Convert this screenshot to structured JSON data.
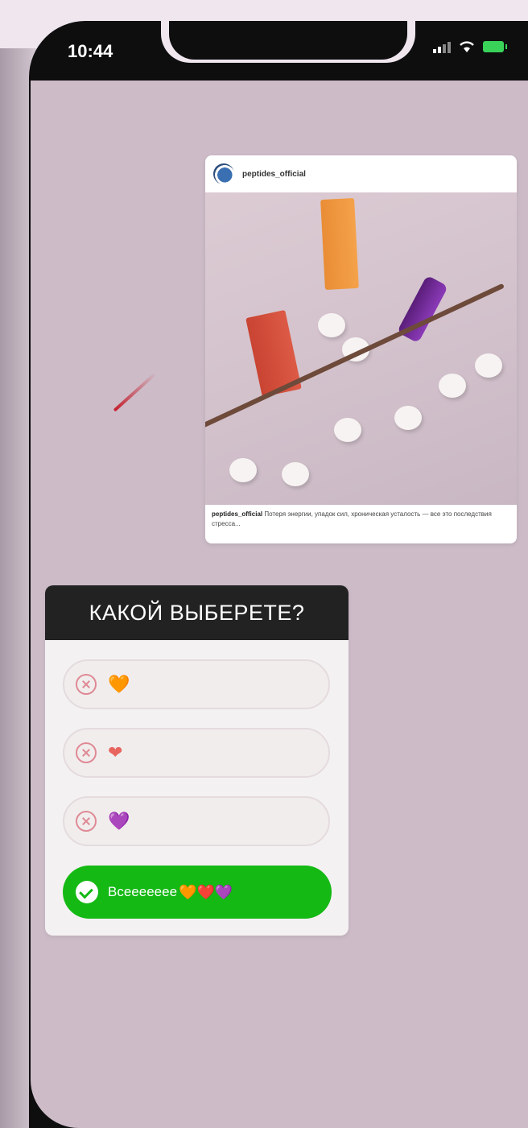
{
  "status_bar": {
    "time": "10:44"
  },
  "post": {
    "username": "peptides_official",
    "caption_user": "peptides_official",
    "caption_text": "Потеря энергии, упадок сил, хроническая усталость — все это последствия стресса..."
  },
  "poll": {
    "title": "КАКОЙ ВЫБЕРЕТЕ?",
    "options": [
      {
        "heart": "🧡",
        "heart_color": "#f2a64a"
      },
      {
        "heart": "❤",
        "heart_color": "#e8655f"
      },
      {
        "heart": "💜",
        "heart_color": "#b26be5"
      }
    ],
    "answer": {
      "text": "Всеееееее",
      "hearts": "🧡❤️💜"
    }
  },
  "colors": {
    "screen_bg": "#cdbcc8",
    "answer_bg": "#14b914",
    "poll_header_bg": "#222222"
  }
}
